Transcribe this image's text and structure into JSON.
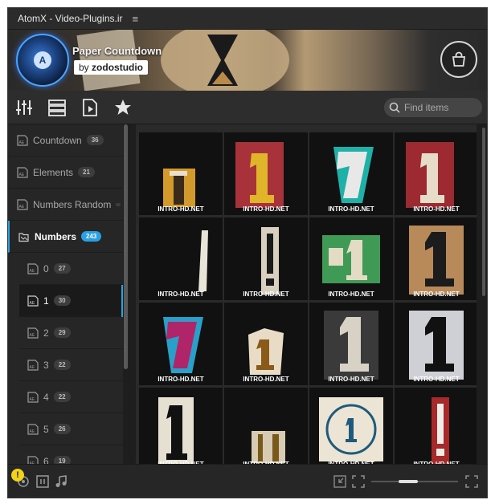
{
  "window": {
    "title": "AtomX - Video-Plugins.ir",
    "menu_icon": "hamburger-menu-icon"
  },
  "banner": {
    "pack_title": "Paper Countdown",
    "author_prefix": "by",
    "author_name": "zodostudio",
    "logo_letter": "A",
    "cart_icon": "shopping-bag-icon"
  },
  "toolbar": {
    "icons": [
      "sliders-icon",
      "list-icon",
      "video-file-icon",
      "star-icon"
    ],
    "search": {
      "placeholder": "Find items",
      "value": ""
    }
  },
  "sidebar": {
    "items": [
      {
        "label": "Countdown",
        "count": "36"
      },
      {
        "label": "Elements",
        "count": "21"
      },
      {
        "label": "Numbers Random",
        "count": ""
      },
      {
        "label": "Numbers",
        "count": "243"
      }
    ],
    "subitems": [
      {
        "label": "0",
        "count": "27"
      },
      {
        "label": "1",
        "count": "30"
      },
      {
        "label": "2",
        "count": "29"
      },
      {
        "label": "3",
        "count": "22"
      },
      {
        "label": "4",
        "count": "22"
      },
      {
        "label": "5",
        "count": "26"
      },
      {
        "label": "6",
        "count": "19"
      }
    ]
  },
  "grid": {
    "watermark": "INTRO-HD.NET",
    "tiles": [
      {
        "paper": "#d19a2a",
        "glyph": "#3a2a1a",
        "style": "narrow"
      },
      {
        "paper": "#a8323a",
        "glyph": "#e0b52a",
        "style": "serif"
      },
      {
        "paper": "#1fb0a8",
        "glyph": "#e8e8e8",
        "style": "slant"
      },
      {
        "paper": "#9c2a30",
        "glyph": "#e7dcc8",
        "style": "serif"
      },
      {
        "paper": "#111111",
        "glyph": "#e8e4d8",
        "style": "strip"
      },
      {
        "paper": "#d9cfbf",
        "glyph": "#1a1a1a",
        "style": "thin"
      },
      {
        "paper": "#3f9a56",
        "glyph": "#e3dbc3",
        "style": "stamp"
      },
      {
        "paper": "#b88a5a",
        "glyph": "#1c1c1c",
        "style": "bold"
      },
      {
        "paper": "#2aa0c8",
        "glyph": "#b0246a",
        "style": "slant"
      },
      {
        "paper": "#e8dcc6",
        "glyph": "#8a5a1a",
        "style": "small"
      },
      {
        "paper": "#3a3a3a",
        "glyph": "#d8d2c6",
        "style": "bold"
      },
      {
        "paper": "#cfcfd6",
        "glyph": "#111111",
        "style": "bold"
      },
      {
        "paper": "#e6e0d2",
        "glyph": "#111111",
        "style": "serif-tall"
      },
      {
        "paper": "#d7cbb3",
        "glyph": "#7a5a1a",
        "style": "low"
      },
      {
        "paper": "#ece4d4",
        "glyph": "#1f5a7a",
        "style": "circle"
      },
      {
        "paper": "#a62a2a",
        "glyph": "#f1ece6",
        "style": "thin"
      }
    ]
  },
  "footer": {
    "warning_mark": "!",
    "icons": [
      "plugin-icon",
      "pause-icon",
      "music-note-icon",
      "collapse-icon",
      "expand-icon",
      "zoom-slider",
      "fullscreen-icon"
    ],
    "zoom_level": 0.4
  },
  "colors": {
    "accent": "#29a3e0",
    "background": "#1e1e1e",
    "sidebar": "#262626",
    "warning": "#f2d21b"
  }
}
